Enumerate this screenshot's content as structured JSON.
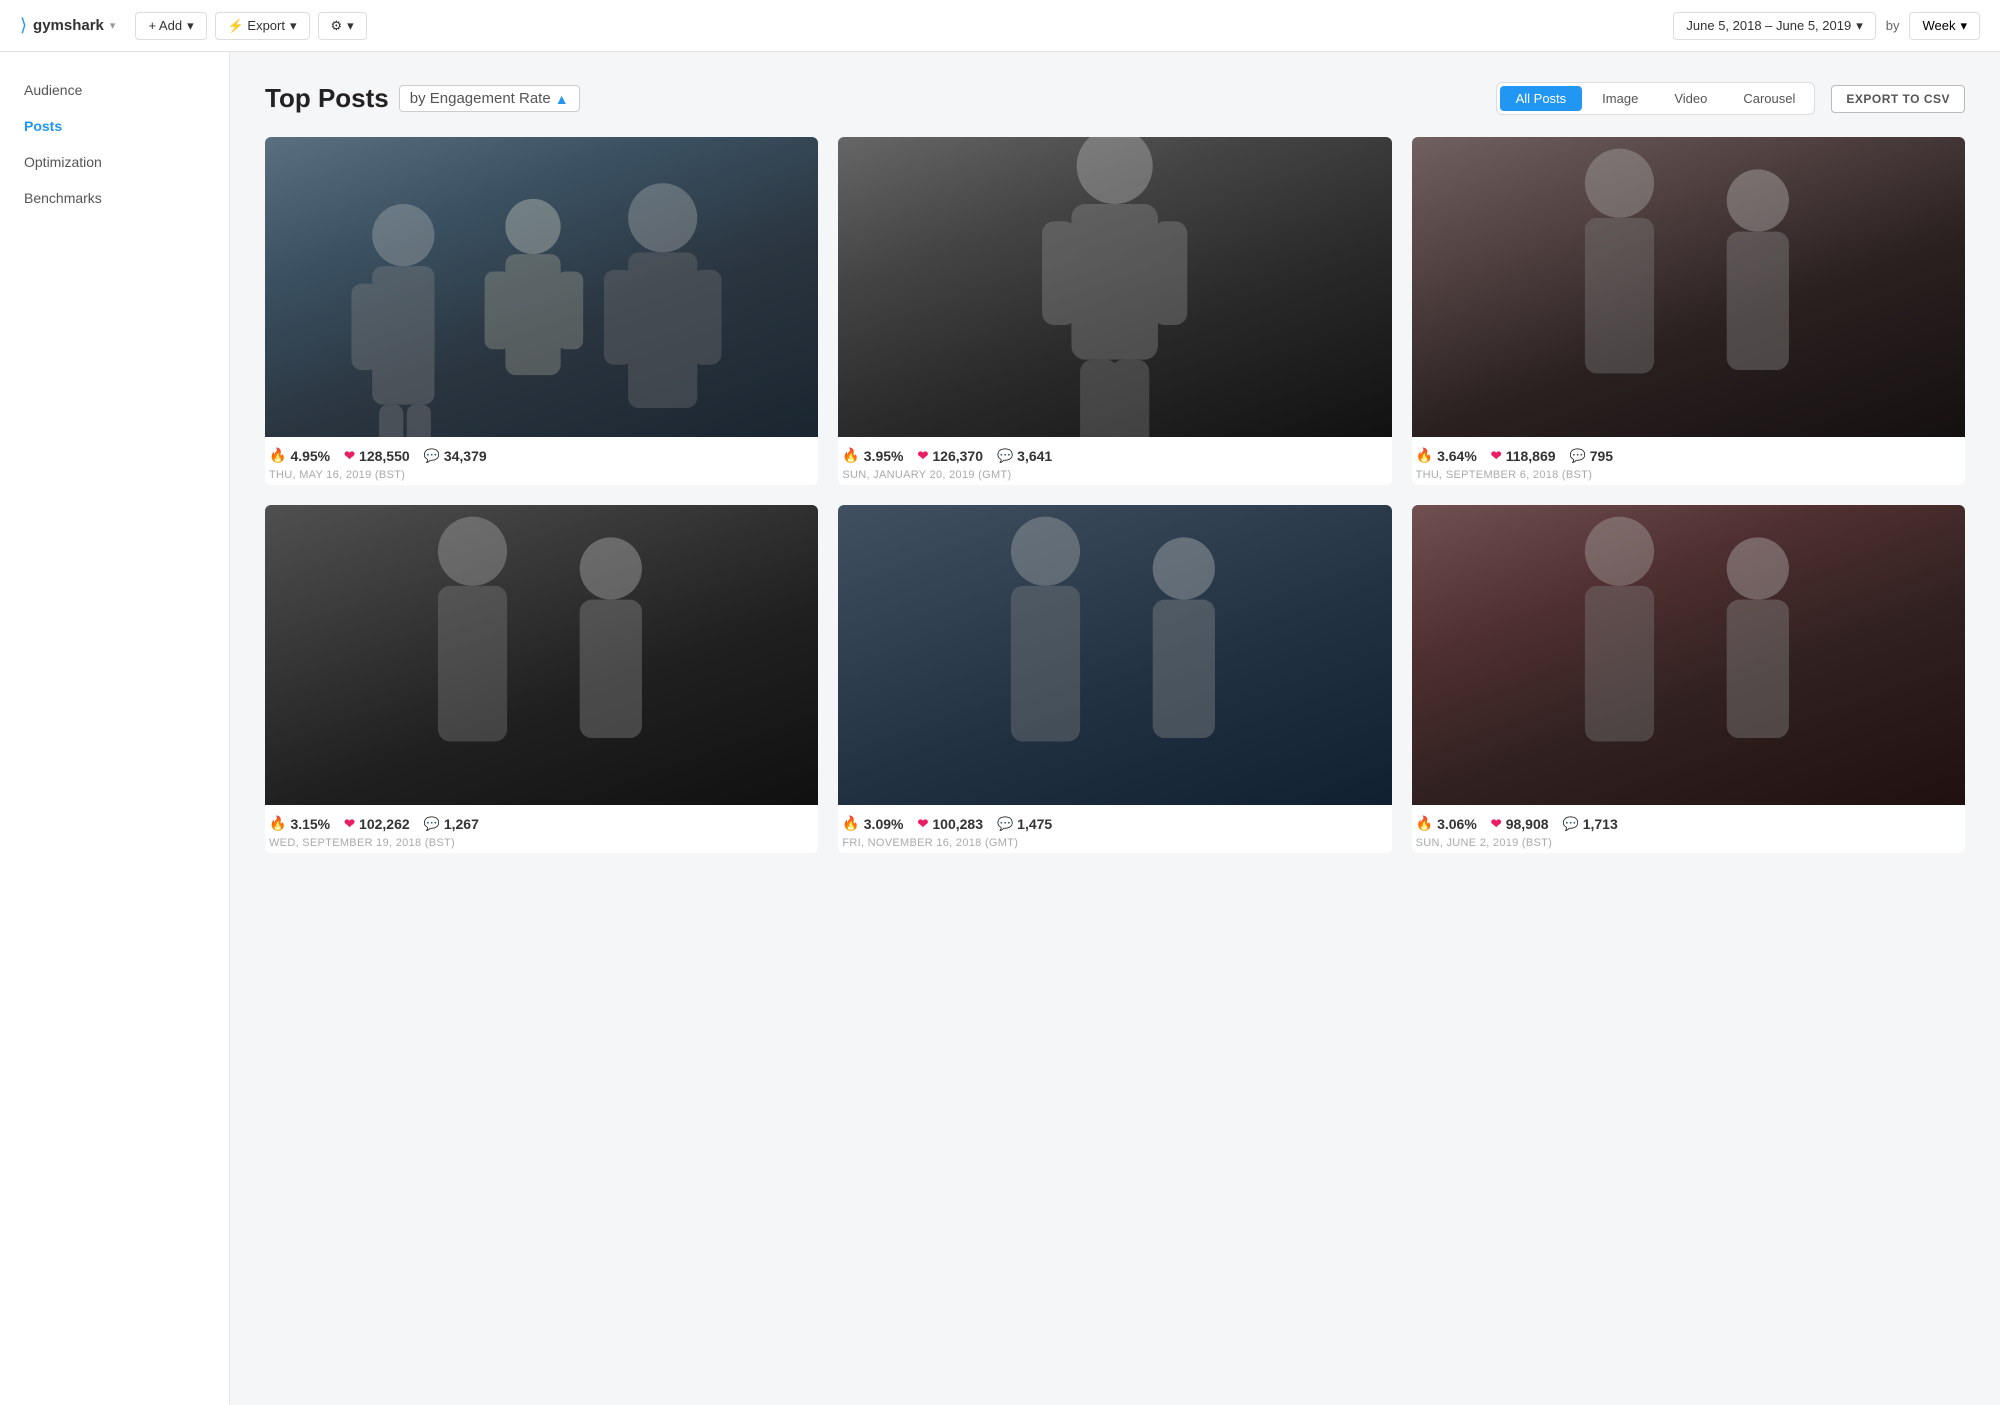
{
  "app": {
    "logo": "7",
    "name": "gymshark",
    "name_arrow": "▾"
  },
  "topnav": {
    "add_label": "+ Add",
    "add_arrow": "▾",
    "export_label": "⚡ Export",
    "export_arrow": "▾",
    "settings_label": "⚙",
    "settings_arrow": "▾",
    "date_range": "June 5, 2018 – June 5, 2019",
    "date_arrow": "▾",
    "by_label": "by",
    "week_label": "Week",
    "week_arrow": "▾"
  },
  "sidebar": {
    "items": [
      {
        "label": "Audience",
        "active": false
      },
      {
        "label": "Posts",
        "active": true
      },
      {
        "label": "Optimization",
        "active": false
      },
      {
        "label": "Benchmarks",
        "active": false
      }
    ]
  },
  "main": {
    "title": "Top Posts",
    "sort_label": "by Engagement Rate",
    "sort_arrow": "▲",
    "export_csv": "EXPORT TO CSV",
    "filter_tabs": [
      {
        "label": "All Posts",
        "active": true
      },
      {
        "label": "Image",
        "active": false
      },
      {
        "label": "Video",
        "active": false
      },
      {
        "label": "Carousel",
        "active": false
      }
    ],
    "posts": [
      {
        "id": 1,
        "engagement": "4.95%",
        "likes": "128,550",
        "comments": "34,379",
        "date": "THU, MAY 16, 2019 (BST)",
        "img_class": "img-1"
      },
      {
        "id": 2,
        "engagement": "3.95%",
        "likes": "126,370",
        "comments": "3,641",
        "date": "SUN, JANUARY 20, 2019 (GMT)",
        "img_class": "img-2"
      },
      {
        "id": 3,
        "engagement": "3.64%",
        "likes": "118,869",
        "comments": "795",
        "date": "THU, SEPTEMBER 6, 2018 (BST)",
        "img_class": "img-3"
      },
      {
        "id": 4,
        "engagement": "3.15%",
        "likes": "102,262",
        "comments": "1,267",
        "date": "WED, SEPTEMBER 19, 2018 (BST)",
        "img_class": "img-4"
      },
      {
        "id": 5,
        "engagement": "3.09%",
        "likes": "100,283",
        "comments": "1,475",
        "date": "FRI, NOVEMBER 16, 2018 (GMT)",
        "img_class": "img-5"
      },
      {
        "id": 6,
        "engagement": "3.06%",
        "likes": "98,908",
        "comments": "1,713",
        "date": "SUN, JUNE 2, 2019 (BST)",
        "img_class": "img-6"
      }
    ]
  }
}
